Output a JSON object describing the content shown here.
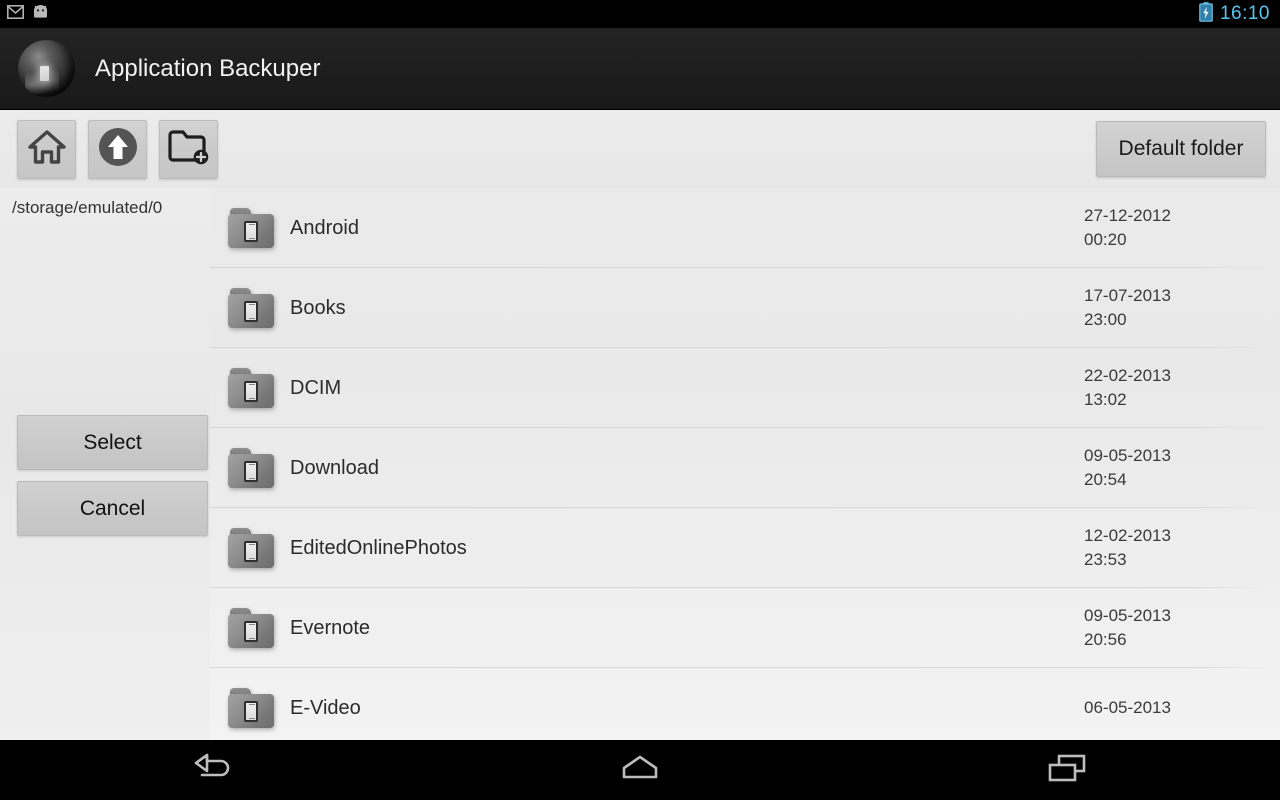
{
  "statusbar": {
    "clock": "16:10",
    "clock_color": "#55c7ef",
    "icons": [
      "gmail-icon",
      "android-head-icon"
    ],
    "battery": "battery-charging-icon"
  },
  "titlebar": {
    "app_title": "Application Backuper",
    "app_icon": "app-globe-icon"
  },
  "toolbar": {
    "buttons": [
      {
        "name": "home-button",
        "icon": "home-icon"
      },
      {
        "name": "up-button",
        "icon": "arrow-up-circle-icon"
      },
      {
        "name": "new-folder-button",
        "icon": "folder-add-icon"
      }
    ],
    "default_folder_label": "Default folder"
  },
  "leftpane": {
    "path": "/storage/emulated/0",
    "select_label": "Select",
    "cancel_label": "Cancel"
  },
  "filelist": {
    "folder_icon": "folder-device-icon",
    "rows": [
      {
        "name": "Android",
        "date": "27-12-2012",
        "time": "00:20"
      },
      {
        "name": "Books",
        "date": "17-07-2013",
        "time": "23:00"
      },
      {
        "name": "DCIM",
        "date": "22-02-2013",
        "time": "13:02"
      },
      {
        "name": "Download",
        "date": "09-05-2013",
        "time": "20:54"
      },
      {
        "name": "EditedOnlinePhotos",
        "date": "12-02-2013",
        "time": "23:53"
      },
      {
        "name": "Evernote",
        "date": "09-05-2013",
        "time": "20:56"
      },
      {
        "name": "E-Video",
        "date": "06-05-2013",
        "time": ""
      }
    ]
  },
  "navbar": {
    "buttons": [
      {
        "name": "nav-back-button",
        "icon": "back-arrow-icon"
      },
      {
        "name": "nav-home-button",
        "icon": "home-outline-icon"
      },
      {
        "name": "nav-recents-button",
        "icon": "recents-icon"
      }
    ]
  }
}
